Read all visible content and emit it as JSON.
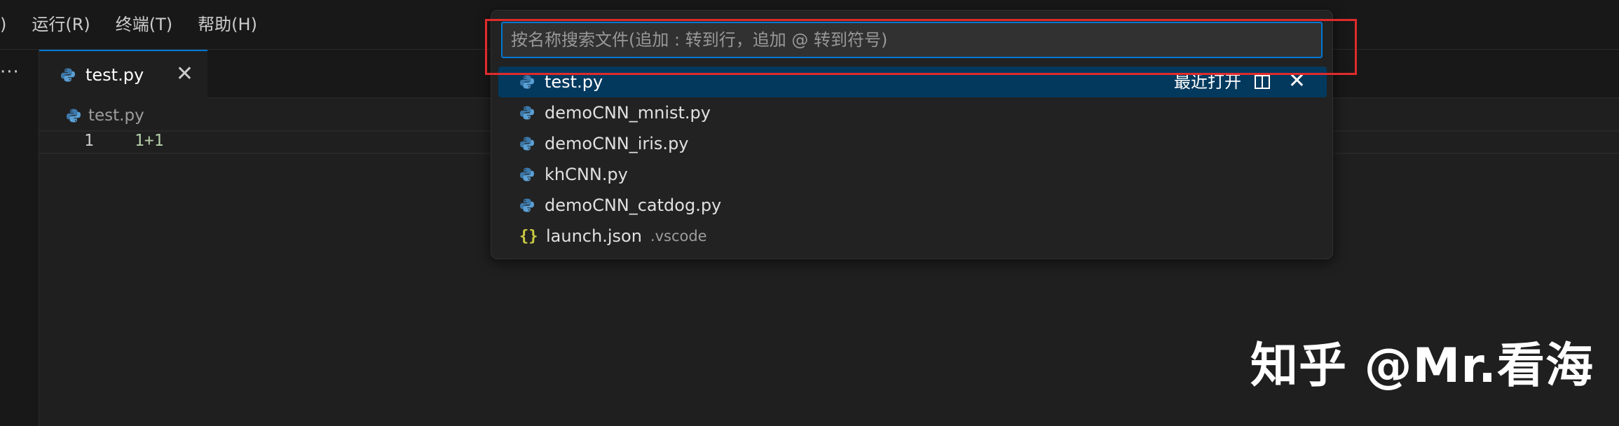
{
  "menubar": {
    "items": [
      ")",
      "运行(R)",
      "终端(T)",
      "帮助(H)"
    ]
  },
  "tab": {
    "label": "test.py",
    "icon": "python-icon"
  },
  "breadcrumb": {
    "file": "test.py"
  },
  "editor": {
    "line_number": "1",
    "code": "1+1"
  },
  "quick_open": {
    "placeholder": "按名称搜索文件(追加 : 转到行，追加 @ 转到符号)",
    "value": "",
    "recent_label": "最近打开",
    "results": [
      {
        "label": "test.py",
        "icon": "python-icon",
        "desc": ""
      },
      {
        "label": "demoCNN_mnist.py",
        "icon": "python-icon",
        "desc": ""
      },
      {
        "label": "demoCNN_iris.py",
        "icon": "python-icon",
        "desc": ""
      },
      {
        "label": "khCNN.py",
        "icon": "python-icon",
        "desc": ""
      },
      {
        "label": "demoCNN_catdog.py",
        "icon": "python-icon",
        "desc": ""
      },
      {
        "label": "launch.json",
        "icon": "json-icon",
        "desc": ".vscode"
      }
    ]
  },
  "icons": {
    "more": "···",
    "close": "✕",
    "json": "{}"
  },
  "colors": {
    "accent": "#0078d4",
    "selection": "#04395e",
    "annotation": "#e02b2b"
  },
  "watermark": "知乎 @Mr.看海"
}
